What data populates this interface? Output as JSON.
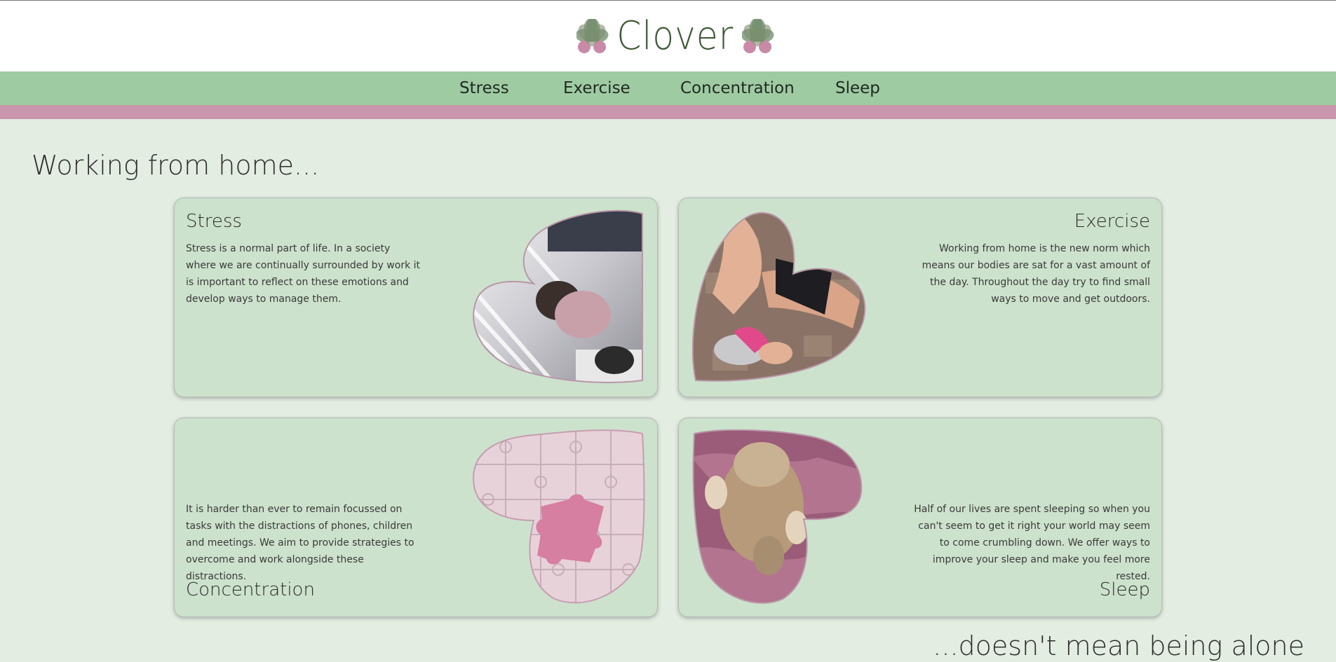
{
  "brand": {
    "name": "Clover",
    "colors": {
      "leaf_green": "#6e8a6a",
      "leaf_pink": "#c98aa8",
      "text_green": "#3e5a36"
    }
  },
  "nav": {
    "items": [
      {
        "label": "Stress"
      },
      {
        "label": "Exercise"
      },
      {
        "label": "Concentration"
      },
      {
        "label": "Sleep"
      }
    ]
  },
  "colors": {
    "header_bg": "#ffffff",
    "nav_bg": "#9fcba3",
    "accent_strip": "#c996ab",
    "page_bg": "#e3ede2",
    "card_bg": "#cce2cc"
  },
  "main": {
    "heading": "Working from home...",
    "closing": "...doesn't mean being alone",
    "cards": [
      {
        "title": "Stress",
        "text": "Stress is a normal part of life. In a society where we are continually surrounded by work it is important to reflect on these emotions and develop ways to manage them.",
        "image": "stressed-person-at-desk-heart-photo"
      },
      {
        "title": "Exercise",
        "text": "Working from home is the new norm which means our bodies are sat for a vast amount of the day. Throughout the day try to find small ways to move and get outdoors.",
        "image": "person-tying-running-shoe-heart-photo"
      },
      {
        "title": "Concentration",
        "text": "It is harder than ever to remain focussed on tasks with the distractions of phones, children and meetings. We aim to provide strategies to overcome and work alongside these distractions.",
        "image": "jigsaw-puzzle-heart-photo"
      },
      {
        "title": "Sleep",
        "text": "Half of our lives are spent sleeping so when you can't seem to get it right your world may seem to come crumbling down. We offer ways to improve your sleep and make you feel more rested.",
        "image": "sleeping-cat-heart-photo"
      }
    ]
  }
}
